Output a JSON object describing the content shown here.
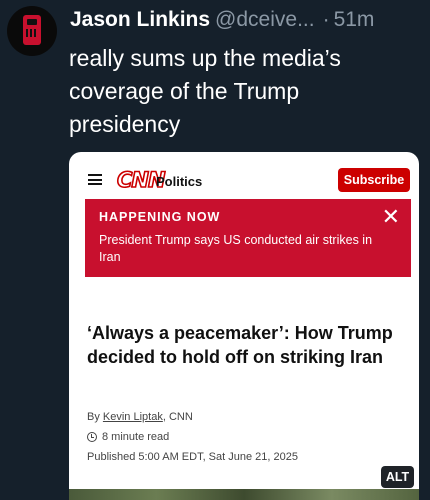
{
  "tweet": {
    "author_name": "Jason Linkins",
    "handle": "@dceive...",
    "separator": "·",
    "time": "51m",
    "text": "really sums up the media’s coverage of the Trump presidency",
    "alt_label": "ALT"
  },
  "card": {
    "logo_text": "CNN",
    "section": "Politics",
    "subscribe_label": "Subscribe",
    "banner": {
      "title": "HAPPENING NOW",
      "text": "President Trump says US conducted air strikes in Iran",
      "close_glyph": "✕"
    },
    "headline": "‘Always a peacemaker’: How Trump decided to hold off on striking Iran",
    "byline_prefix": "By ",
    "author": "Kevin Liptak",
    "byline_suffix": ", CNN",
    "read_time": "8 minute read",
    "published": "Published 5:00 AM EDT, Sat June 21, 2025"
  },
  "icons": {
    "avatar": "device-avatar-icon",
    "menu": "hamburger-menu-icon",
    "close": "close-icon",
    "clock": "clock-icon"
  },
  "colors": {
    "background": "#15202b",
    "cnn_red": "#cc0000",
    "muted_text": "#8b98a5"
  }
}
